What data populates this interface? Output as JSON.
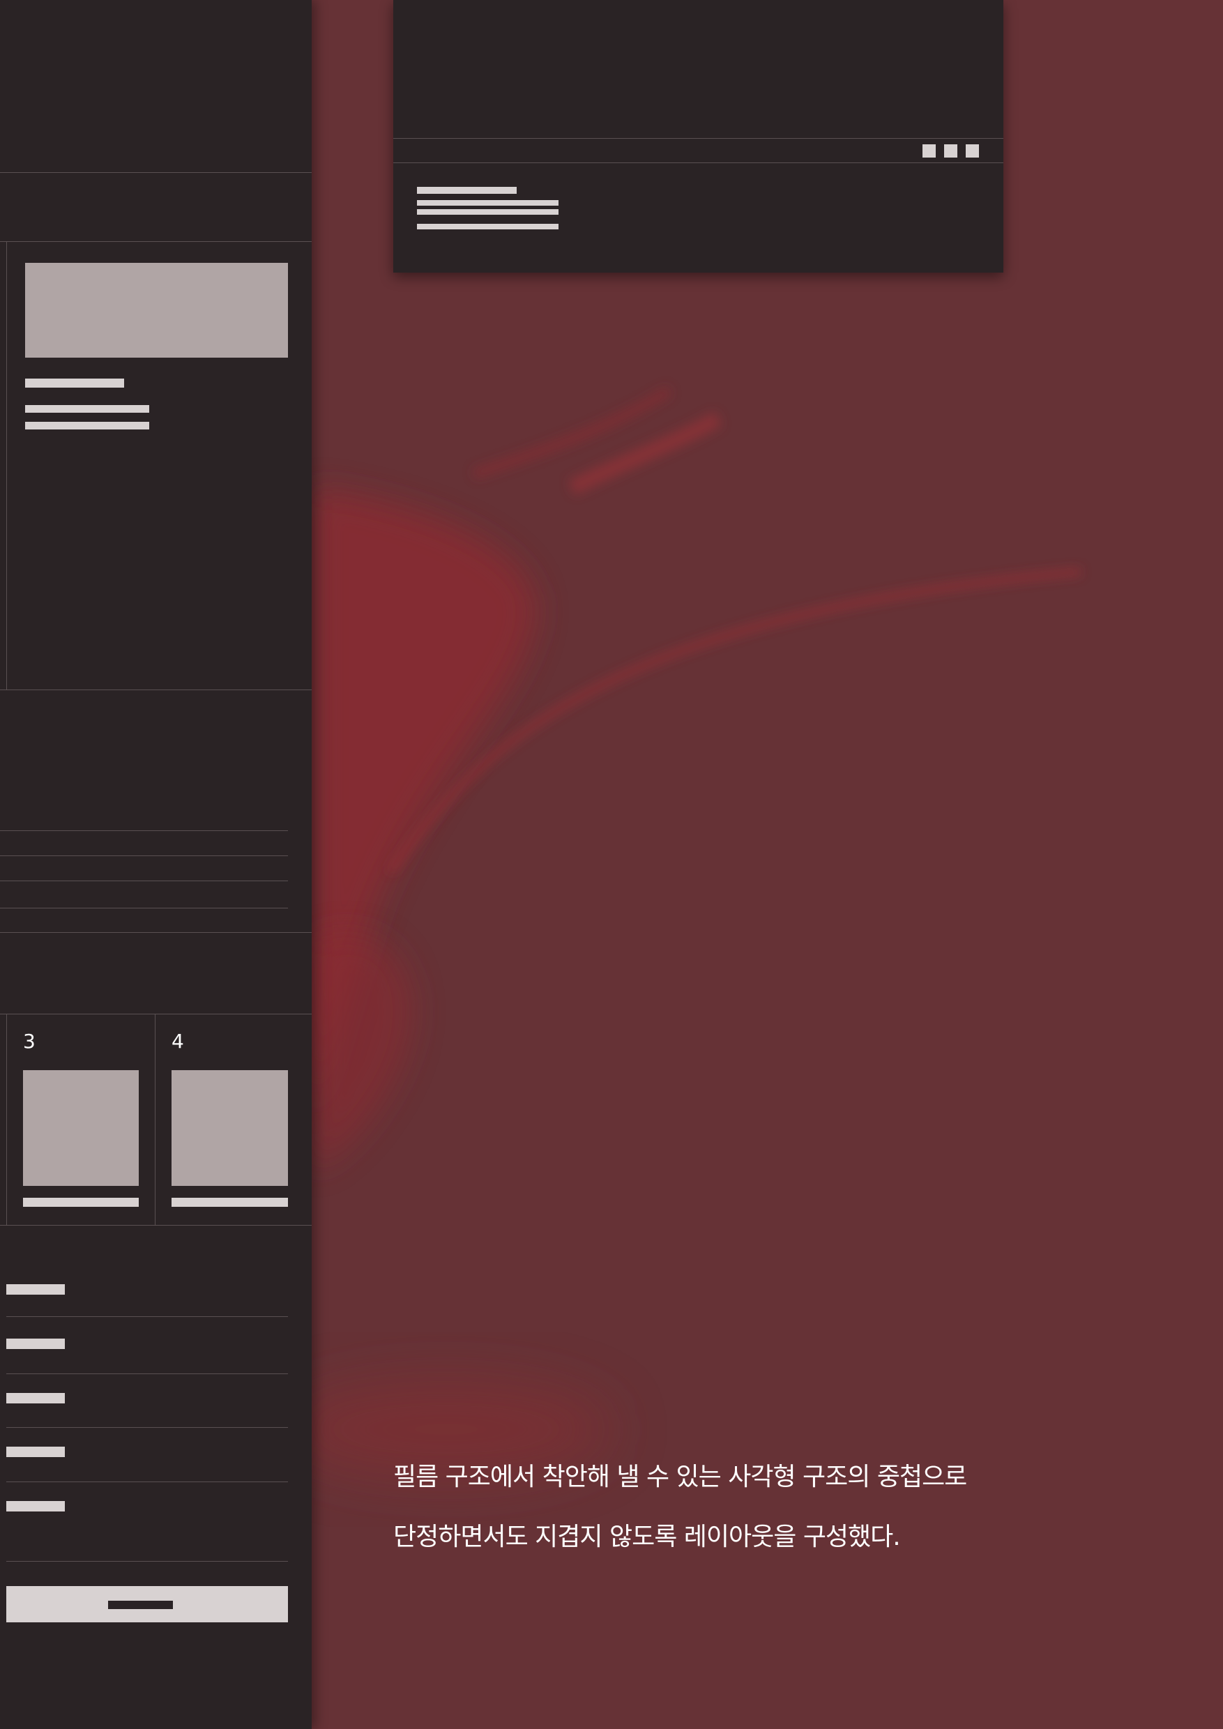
{
  "palette": {
    "background": "#663236",
    "panel": "#2a2325",
    "placeholder": "#b0a5a5",
    "text_bar": "#d8d2d2",
    "accent_red": "#9a2a30"
  },
  "thumbnails": [
    {
      "number": "3"
    },
    {
      "number": "4"
    }
  ],
  "mockup": {
    "window_controls": [
      "square-icon",
      "square-icon",
      "square-icon"
    ]
  },
  "caption": {
    "line1": "필름 구조에서 착안해 낼 수 있는 사각형 구조의 중첩으로",
    "line2": "단정하면서도 지겹지 않도록 레이아웃을 구성했다."
  }
}
